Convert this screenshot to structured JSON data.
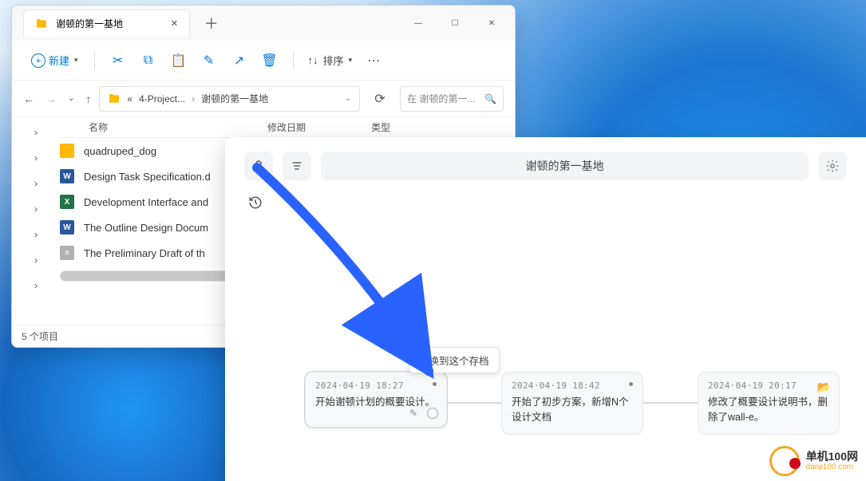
{
  "explorer": {
    "tab_title": "谢顿的第一基地",
    "new_label": "新建",
    "sort_label": "排序",
    "breadcrumb": {
      "root_marker": "«",
      "level1": "4-Project...",
      "level2": "谢顿的第一基地"
    },
    "search_placeholder": "在 谢顿的第一...",
    "columns": {
      "name": "名称",
      "date": "修改日期",
      "type": "类型"
    },
    "files": [
      {
        "icon": "folder",
        "name": "quadruped_dog"
      },
      {
        "icon": "word",
        "name": "Design Task Specification.d"
      },
      {
        "icon": "excel",
        "name": "Development Interface and"
      },
      {
        "icon": "word",
        "name": "The Outline Design Docum"
      },
      {
        "icon": "txt",
        "name": "The Preliminary Draft of th"
      }
    ],
    "status": "5 个项目"
  },
  "app": {
    "title": "谢顿的第一基地",
    "tooltip": "切换到这个存档",
    "cards": [
      {
        "ts": "2024·04·19 18:27",
        "desc": "开始谢顿计划的概要设计。",
        "active": true,
        "edit": true,
        "circle": true,
        "dot": true
      },
      {
        "ts": "2024·04·19 18:42",
        "desc": "开始了初步方案，新增N个设计文档",
        "dot": true
      },
      {
        "ts": "2024·04·19 20:17",
        "desc": "修改了概要设计说明书，删除了wall-e。",
        "folder": true
      }
    ]
  },
  "watermark": {
    "line1": "单机100网",
    "line2": "danji100.com"
  }
}
